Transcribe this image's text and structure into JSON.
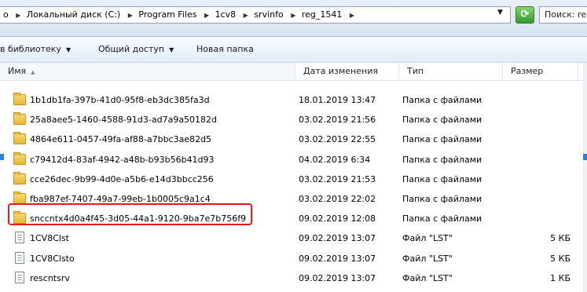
{
  "address_bar": {
    "crumbs": [
      "Локальный диск (C:)",
      "Program Files",
      "1cv8",
      "srvinfo",
      "reg_1541"
    ],
    "lead_fragment": "о",
    "search_placeholder": "Поиск: re"
  },
  "toolbar": {
    "library_label": "в библиотеку",
    "share_label": "Общий доступ",
    "new_folder_label": "Новая папка"
  },
  "columns": {
    "name": "Имя",
    "date": "Дата изменения",
    "type": "Тип",
    "size": "Размер"
  },
  "files": [
    {
      "name": "1b1db1fa-397b-41d0-95f8-eb3dc385fa3d",
      "date": "18.01.2019 13:47",
      "type": "Папка с файлами",
      "size": "",
      "icon": "folder-icon"
    },
    {
      "name": "25a8aee5-1460-4588-91d3-ad7a9a50182d",
      "date": "03.02.2019 21:56",
      "type": "Папка с файлами",
      "size": "",
      "icon": "folder-icon"
    },
    {
      "name": "4864e611-0457-49fa-af88-a7bbc3ae82d5",
      "date": "03.02.2019 22:55",
      "type": "Папка с файлами",
      "size": "",
      "icon": "folder-icon"
    },
    {
      "name": "c79412d4-83af-4942-a48b-b93b56b41d93",
      "date": "04.02.2019 6:34",
      "type": "Папка с файлами",
      "size": "",
      "icon": "folder-icon"
    },
    {
      "name": "cce26dec-9b99-4d0e-a5b6-e14d3bbcc256",
      "date": "03.02.2019 21:53",
      "type": "Папка с файлами",
      "size": "",
      "icon": "folder-icon"
    },
    {
      "name": "fba987ef-7407-49a7-99eb-1b0005c9a1c4",
      "date": "03.02.2019 22:02",
      "type": "Папка с файлами",
      "size": "",
      "icon": "folder-icon"
    },
    {
      "name": "snccntx4d0a4f45-3d05-44a1-9120-9ba7e7b756f9",
      "date": "09.02.2019 12:08",
      "type": "Папка с файлами",
      "size": "",
      "icon": "folder-icon"
    },
    {
      "name": "1CV8Clst",
      "date": "09.02.2019 13:07",
      "type": "Файл \"LST\"",
      "size": "5 КБ",
      "icon": "file-icon"
    },
    {
      "name": "1CV8Clsto",
      "date": "09.02.2019 13:07",
      "type": "Файл \"LST\"",
      "size": "5 КБ",
      "icon": "file-icon"
    },
    {
      "name": "rescntsrv",
      "date": "09.02.2019 13:07",
      "type": "Файл \"LST\"",
      "size": "1 КБ",
      "icon": "file-icon"
    }
  ],
  "highlight": {
    "color": "#e8191a",
    "row_name": "snccntx4d0a4f45-3d05-44a1-9120-9ba7e7b756f9"
  }
}
